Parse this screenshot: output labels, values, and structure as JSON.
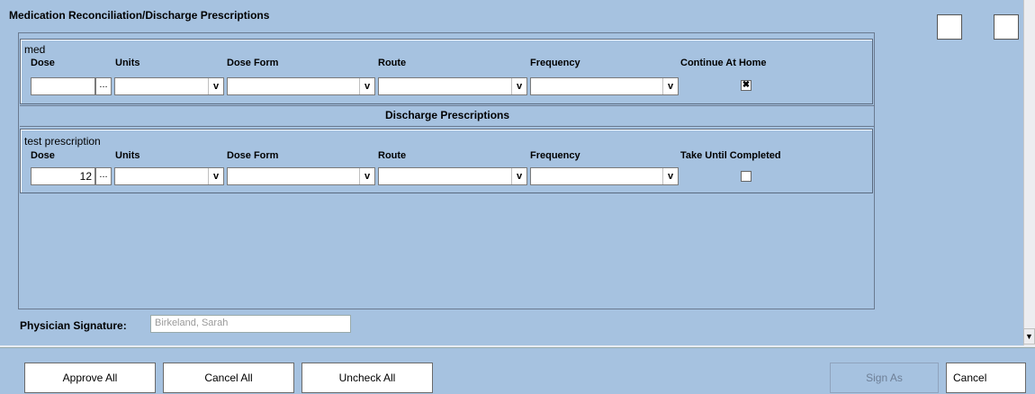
{
  "panel": {
    "title": "Medication Reconciliation/Discharge Prescriptions"
  },
  "reconciliation": {
    "med_name": "med",
    "columns": [
      "Dose",
      "Units",
      "Dose Form",
      "Route",
      "Frequency",
      "Continue At Home"
    ],
    "dose_value": "",
    "continue_checked": true,
    "check_glyph": "✖"
  },
  "discharge": {
    "header": "Discharge Prescriptions",
    "med_name": "test prescription",
    "columns": [
      "Dose",
      "Units",
      "Dose Form",
      "Route",
      "Frequency",
      "Take Until Completed"
    ],
    "dose_value": "12",
    "take_until_completed_checked": false
  },
  "ellipsis_label": "...",
  "dropdown_arrow": "v",
  "signature": {
    "label": "Physician Signature:",
    "value": "Birkeland, Sarah"
  },
  "buttons": {
    "approve_all": "Approve All",
    "cancel_all": "Cancel All",
    "uncheck_all": "Uncheck All",
    "sign_as": "Sign As",
    "cancel": "Cancel"
  },
  "scroll_down_glyph": "▼",
  "colors": {
    "background": "#a6c2e0",
    "field": "#ffffff"
  }
}
